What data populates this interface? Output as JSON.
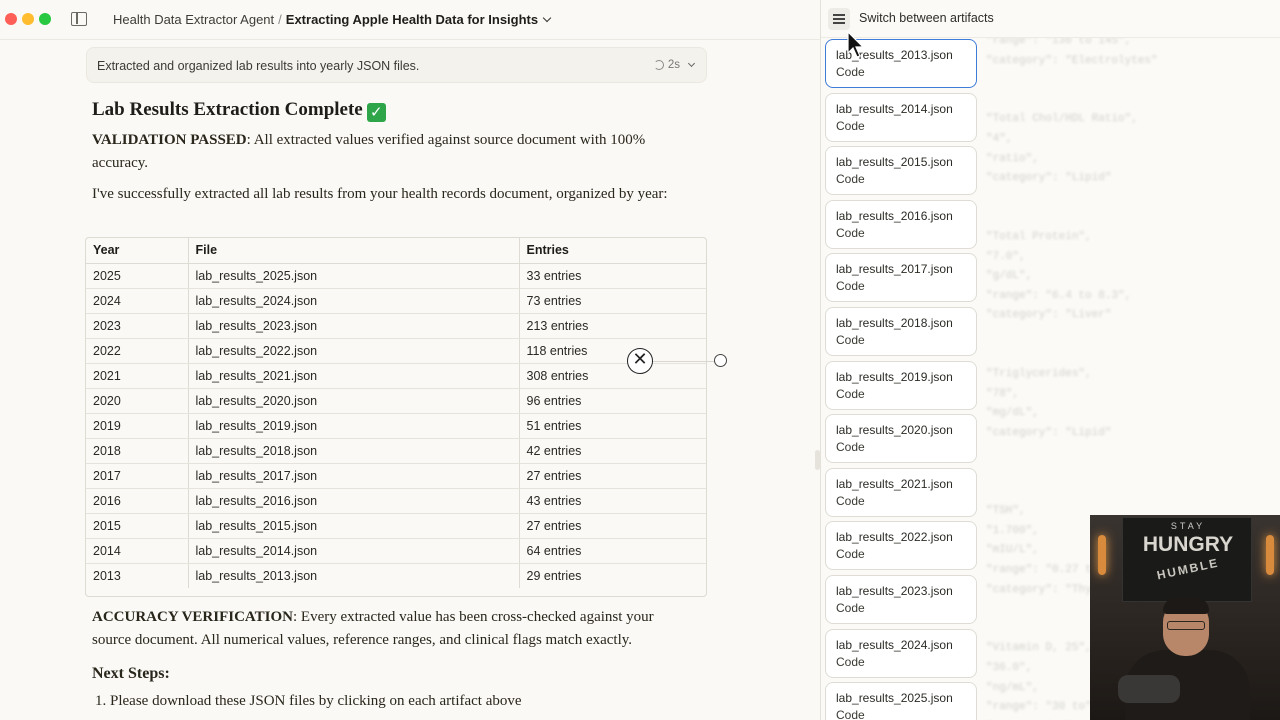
{
  "titlebar": {
    "traffic_colors": [
      "#ff5f57",
      "#febc2e",
      "#28c840"
    ],
    "breadcrumb_project": "Health Data Extractor Agent",
    "breadcrumb_sep": "/",
    "breadcrumb_current": "Extracting Apple Health Data for Insights"
  },
  "status": {
    "text": "Extracted and organized lab results into yearly JSON files.",
    "timer": "2s"
  },
  "content": {
    "heading": "Lab Results Extraction Complete",
    "check_icon": "✓",
    "validation_label": "VALIDATION PASSED",
    "validation_text": ": All extracted values verified against source document with 100% accuracy.",
    "intro": "I've successfully extracted all lab results from your health records document, organized by year:",
    "table": {
      "headers": [
        "Year",
        "File",
        "Entries"
      ],
      "rows": [
        [
          "2025",
          "lab_results_2025.json",
          "33 entries"
        ],
        [
          "2024",
          "lab_results_2024.json",
          "73 entries"
        ],
        [
          "2023",
          "lab_results_2023.json",
          "213 entries"
        ],
        [
          "2022",
          "lab_results_2022.json",
          "118 entries"
        ],
        [
          "2021",
          "lab_results_2021.json",
          "308 entries"
        ],
        [
          "2020",
          "lab_results_2020.json",
          "96 entries"
        ],
        [
          "2019",
          "lab_results_2019.json",
          "51 entries"
        ],
        [
          "2018",
          "lab_results_2018.json",
          "42 entries"
        ],
        [
          "2017",
          "lab_results_2017.json",
          "27 entries"
        ],
        [
          "2016",
          "lab_results_2016.json",
          "43 entries"
        ],
        [
          "2015",
          "lab_results_2015.json",
          "27 entries"
        ],
        [
          "2014",
          "lab_results_2014.json",
          "64 entries"
        ],
        [
          "2013",
          "lab_results_2013.json",
          "29 entries"
        ]
      ]
    },
    "accuracy_label": "ACCURACY VERIFICATION",
    "accuracy_text": ": Every extracted value has been cross-checked against your source document. All numerical values, reference ranges, and clinical flags match exactly.",
    "next_steps": "Next Steps:",
    "step1": "1. Please download these JSON files by clicking on each artifact above"
  },
  "artifacts_panel": {
    "switch_label": "Switch between artifacts",
    "items": [
      {
        "title": "lab_results_2013.json",
        "type": "Code"
      },
      {
        "title": "lab_results_2014.json",
        "type": "Code"
      },
      {
        "title": "lab_results_2015.json",
        "type": "Code"
      },
      {
        "title": "lab_results_2016.json",
        "type": "Code"
      },
      {
        "title": "lab_results_2017.json",
        "type": "Code"
      },
      {
        "title": "lab_results_2018.json",
        "type": "Code"
      },
      {
        "title": "lab_results_2019.json",
        "type": "Code"
      },
      {
        "title": "lab_results_2020.json",
        "type": "Code"
      },
      {
        "title": "lab_results_2021.json",
        "type": "Code"
      },
      {
        "title": "lab_results_2022.json",
        "type": "Code"
      },
      {
        "title": "lab_results_2023.json",
        "type": "Code"
      },
      {
        "title": "lab_results_2024.json",
        "type": "Code"
      },
      {
        "title": "lab_results_2025.json",
        "type": "Code"
      }
    ],
    "background_code": "\"range\": \"136 to 145\",\n\"category\": \"Electrolytes\"\n\n\n\"Total Chol/HDL Ratio\",\n\"4\",\n\"ratio\",\n\"category\": \"Lipid\"\n\n\n\"Total Protein\",\n\"7.0\",\n\"g/dL\",\n\"range\": \"6.4 to 8.3\",\n\"category\": \"Liver\"\n\n\n\"Triglycerides\",\n\"78\",\n\"mg/dL\",\n\"category\": \"Lipid\"\n\n\n\n\"TSH\",\n\"1.700\",\n\"mIU/L\",\n\"range\": \"0.27 to\",\n\"category\": \"Thyroid\"\n\n\n\"Vitamin D, 25\",\n\"36.0\",\n\"ng/mL\",\n\"range\": \"30 to\",\n\"category\": \"Vitamin\""
  },
  "webcam": {
    "sign_top": "STAY",
    "sign_main": "HUNGRY",
    "sign_bottom": "HUMBLE"
  }
}
